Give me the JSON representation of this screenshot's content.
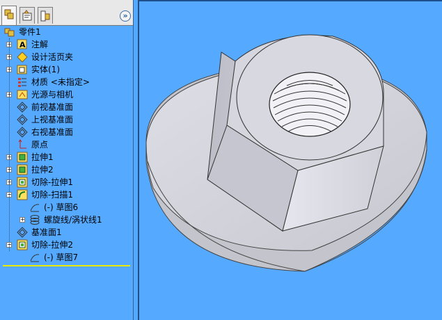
{
  "feature_manager": {
    "tabs": [
      {
        "name": "featuremanager-tab",
        "active": true
      },
      {
        "name": "propertymanager-tab",
        "active": false
      },
      {
        "name": "configurationmanager-tab",
        "active": false
      }
    ],
    "collapse_label": "»",
    "tree": [
      {
        "label": "零件1",
        "icon": "part-icon",
        "expander": ""
      },
      {
        "label": "注解",
        "icon": "annotations-icon",
        "expander": "+"
      },
      {
        "label": "设计活页夹",
        "icon": "design-binder-icon",
        "expander": "+"
      },
      {
        "label": "实体(1)",
        "icon": "solid-bodies-icon",
        "expander": "+"
      },
      {
        "label": "材质 <未指定>",
        "icon": "material-icon",
        "expander": ""
      },
      {
        "label": "光源与相机",
        "icon": "lights-cameras-icon",
        "expander": "+"
      },
      {
        "label": "前视基准面",
        "icon": "plane-icon",
        "expander": ""
      },
      {
        "label": "上视基准面",
        "icon": "plane-icon",
        "expander": ""
      },
      {
        "label": "右视基准面",
        "icon": "plane-icon",
        "expander": ""
      },
      {
        "label": "原点",
        "icon": "origin-icon",
        "expander": ""
      },
      {
        "label": "拉伸1",
        "icon": "extrude-icon",
        "expander": "+"
      },
      {
        "label": "拉伸2",
        "icon": "extrude-icon",
        "expander": "+"
      },
      {
        "label": "切除-拉伸1",
        "icon": "cut-extrude-icon",
        "expander": "+"
      },
      {
        "label": "切除-扫描1",
        "icon": "cut-sweep-icon",
        "expander": "-"
      },
      {
        "label": "(-) 草图6",
        "icon": "sketch-icon",
        "expander": ""
      },
      {
        "label": "螺旋线/涡状线1",
        "icon": "helix-icon",
        "expander": "+"
      },
      {
        "label": "基准面1",
        "icon": "plane-icon",
        "expander": ""
      },
      {
        "label": "切除-拉伸2",
        "icon": "cut-extrude-icon",
        "expander": "-"
      },
      {
        "label": "(-) 草图7",
        "icon": "sketch-icon",
        "expander": ""
      }
    ]
  },
  "colors": {
    "background": "#55aaff",
    "nut": "#d8d8e0",
    "nut_shade": "#b8b8c2",
    "nut_dark": "#9a9aa6"
  }
}
